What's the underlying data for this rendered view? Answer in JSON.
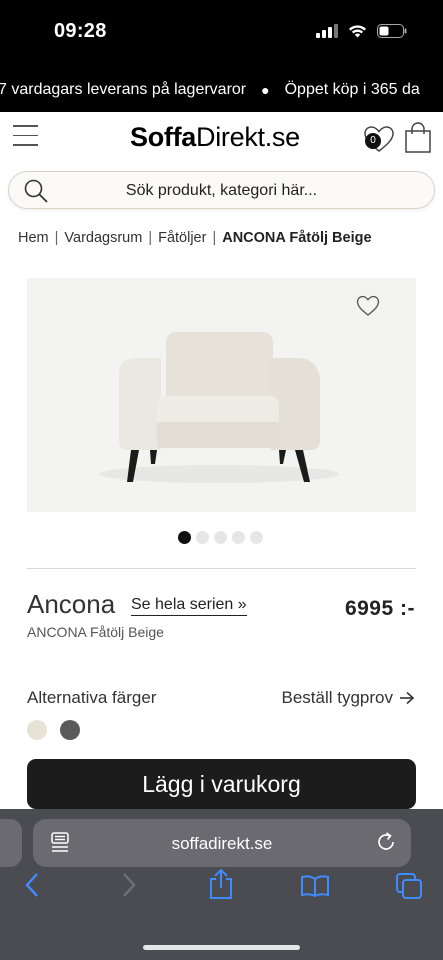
{
  "status_bar": {
    "time": "09:28"
  },
  "marquee": {
    "text_left": "7 vardagars leverans på lagervaror",
    "separator": "●",
    "text_right": "Öppet köp i 365 da"
  },
  "header": {
    "logo_bold": "Soffa",
    "logo_regular": "Direkt.se",
    "wishlist_count": "0"
  },
  "search": {
    "placeholder": "Sök produkt, kategori här..."
  },
  "breadcrumb": {
    "items": [
      "Hem",
      "Vardagsrum",
      "Fåtöljer"
    ],
    "current": "ANCONA Fåtölj Beige",
    "separator": "|"
  },
  "gallery": {
    "image_count": 5,
    "active_index": 0
  },
  "product": {
    "name": "Ancona",
    "series_link": "Se hela serien »",
    "price": "6995 :-",
    "subtitle": "ANCONA Fåtölj Beige"
  },
  "colors": {
    "label": "Alternativa färger",
    "order_sample": "Beställ tygprov",
    "swatches": [
      "#e7e2d6",
      "#5b5a5a"
    ]
  },
  "cart": {
    "button_label": "Lägg i varukorg"
  },
  "browser": {
    "url": "soffadirekt.se"
  },
  "theme": {
    "accent": "#1c1c1c",
    "toolbar_blue": "#3f8cff"
  }
}
